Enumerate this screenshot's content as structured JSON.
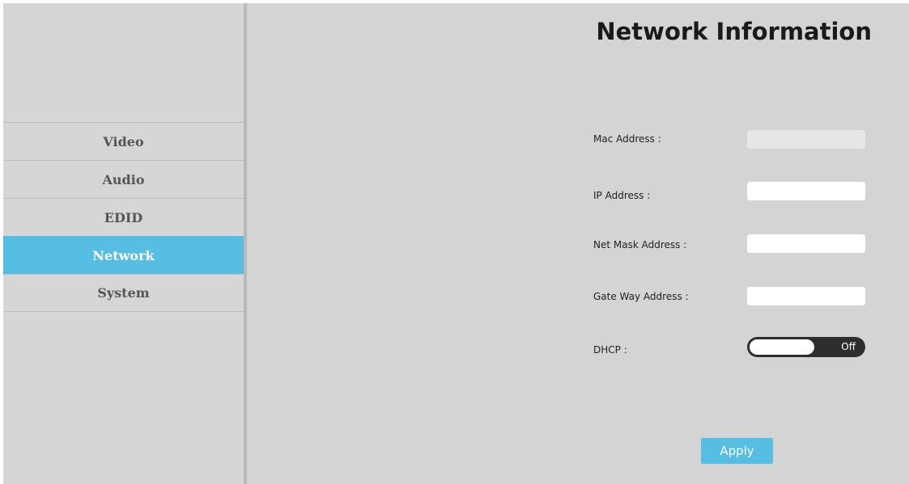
{
  "sidebar": {
    "items": [
      {
        "label": "Video",
        "active": false
      },
      {
        "label": "Audio",
        "active": false
      },
      {
        "label": "EDID",
        "active": false
      },
      {
        "label": "Network",
        "active": true
      },
      {
        "label": "System",
        "active": false
      }
    ]
  },
  "main": {
    "title": "Network Information",
    "fields": {
      "mac": {
        "label": "Mac Address :",
        "value": ""
      },
      "ip": {
        "label": "IP Address :",
        "value": ""
      },
      "netmask": {
        "label": "Net Mask Address :",
        "value": ""
      },
      "gateway": {
        "label": "Gate Way Address :",
        "value": ""
      }
    },
    "dhcp": {
      "label": "DHCP :",
      "state": "Off"
    },
    "apply_label": "Apply"
  },
  "colors": {
    "accent": "#56bde3",
    "background": "#d4d4d4",
    "toggle": "#2e2e2e"
  }
}
